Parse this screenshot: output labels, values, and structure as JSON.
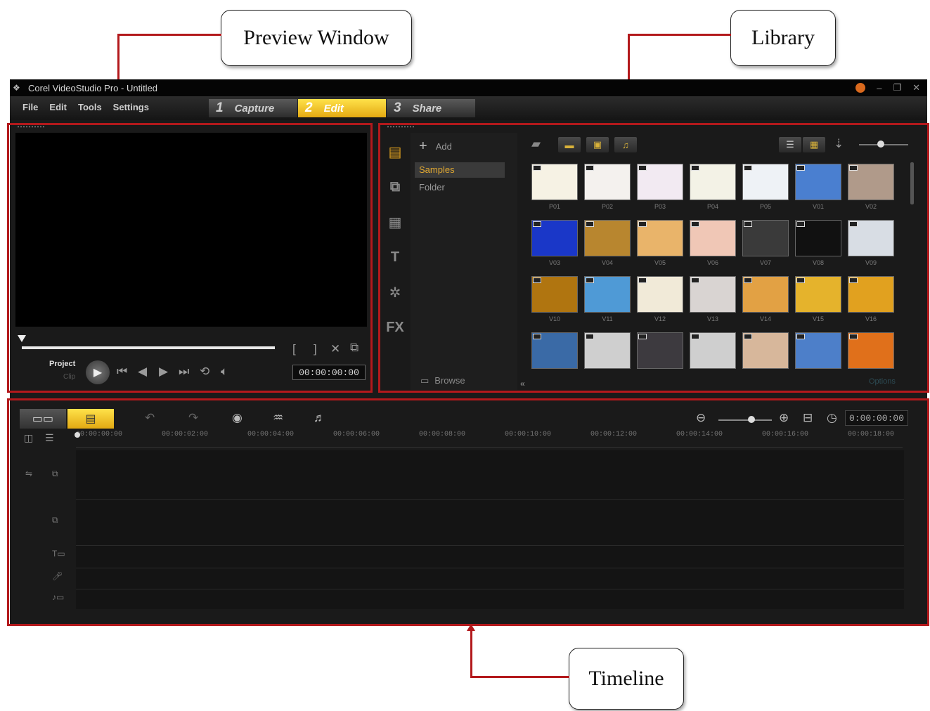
{
  "callouts": {
    "preview": "Preview Window",
    "library": "Library",
    "timeline": "Timeline"
  },
  "window": {
    "title": "Corel VideoStudio Pro - Untitled",
    "accent_color": "#e2a21f",
    "annotation_color": "#b3191c"
  },
  "menu": {
    "file": "File",
    "edit": "Edit",
    "tools": "Tools",
    "settings": "Settings"
  },
  "steps": [
    {
      "num": "1",
      "label": "Capture"
    },
    {
      "num": "2",
      "label": "Edit"
    },
    {
      "num": "3",
      "label": "Share"
    }
  ],
  "preview": {
    "mode_label": "Project",
    "clip_label": "Clip",
    "timecode": "00:00:00:00"
  },
  "library": {
    "add_label": "Add",
    "tree": [
      "Samples",
      "Folder"
    ],
    "browse_label": "Browse",
    "options_label": "Options",
    "side_icons": [
      "media-icon",
      "transition-icon",
      "graphics-icon",
      "title-icon",
      "filter-icon",
      "fx-icon"
    ],
    "thumbnails": [
      [
        "P01",
        "P02",
        "P03",
        "P04",
        "P05",
        "V01",
        "V02"
      ],
      [
        "V03",
        "V04",
        "V05",
        "V06",
        "V07",
        "V08",
        "V09"
      ],
      [
        "V10",
        "V11",
        "V12",
        "V13",
        "V14",
        "V15",
        "V16"
      ],
      [
        "",
        "",
        "",
        "",
        "",
        "",
        ""
      ]
    ]
  },
  "timeline": {
    "clock": "0:00:00:00",
    "ruler": [
      "00:00:00:00",
      "00:00:02:00",
      "00:00:04:00",
      "00:00:06:00",
      "00:00:08:00",
      "00:00:10:00",
      "00:00:12:00",
      "00:00:14:00",
      "00:00:16:00",
      "00:00:18:00"
    ]
  }
}
